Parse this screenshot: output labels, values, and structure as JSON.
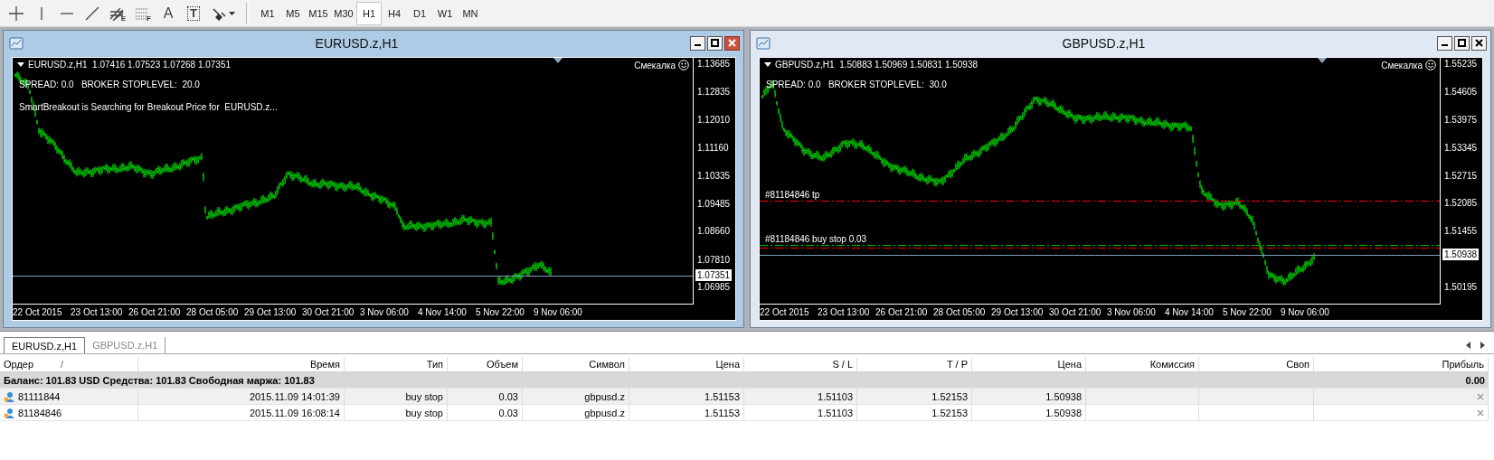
{
  "toolbar": {
    "tools": [
      {
        "kind": "crosshair"
      },
      {
        "kind": "vline"
      },
      {
        "kind": "hline"
      },
      {
        "kind": "trendline"
      },
      {
        "kind": "fibo_fan",
        "glyph": "E"
      },
      {
        "kind": "fibo_lines",
        "glyph": "F"
      },
      {
        "kind": "text",
        "glyph": "A"
      },
      {
        "kind": "label",
        "glyph": "T"
      },
      {
        "kind": "arrows"
      }
    ],
    "timeframes": [
      {
        "label": "M1",
        "selected": false
      },
      {
        "label": "M5",
        "selected": false
      },
      {
        "label": "M15",
        "selected": false
      },
      {
        "label": "M30",
        "selected": false
      },
      {
        "label": "H1",
        "selected": true
      },
      {
        "label": "H4",
        "selected": false
      },
      {
        "label": "D1",
        "selected": false
      },
      {
        "label": "W1",
        "selected": false
      },
      {
        "label": "MN",
        "selected": false
      }
    ]
  },
  "charts": [
    {
      "title": "EURUSD.z,H1",
      "active": true,
      "header": "EURUSD.z,H1  1.07416 1.07523 1.07268 1.07351",
      "expert": "Смекалка",
      "info_lines": [
        "SPREAD: 0.0   BROKER STOPLEVEL:  20.0",
        "SmartBreakout is Searching for Breakout Price for  EURUSD.z..."
      ],
      "price_ticks": [
        "1.13685",
        "1.12835",
        "1.12010",
        "1.11160",
        "1.10335",
        "1.09485",
        "1.08660",
        "1.07810",
        "1.06985"
      ],
      "current_price": "1.07351",
      "time_labels": [
        "22 Oct 2015",
        "23 Oct 13:00",
        "26 Oct 21:00",
        "28 Oct 05:00",
        "29 Oct 13:00",
        "30 Oct 21:00",
        "3 Nov 06:00",
        "4 Nov 14:00",
        "5 Nov 22:00",
        "9 Nov 06:00"
      ]
    },
    {
      "title": "GBPUSD.z,H1",
      "active": false,
      "header": "GBPUSD.z,H1  1.50883 1.50969 1.50831 1.50938",
      "expert": "Смекалка",
      "info_lines": [
        "SPREAD: 0.0   BROKER STOPLEVEL:  30.0"
      ],
      "price_ticks": [
        "1.55235",
        "1.54605",
        "1.53975",
        "1.53345",
        "1.52715",
        "1.52085",
        "1.51455",
        "1.50195"
      ],
      "current_price": "1.50938",
      "time_labels": [
        "22 Oct 2015",
        "23 Oct 13:00",
        "26 Oct 21:00",
        "28 Oct 05:00",
        "29 Oct 13:00",
        "30 Oct 21:00",
        "3 Nov 06:00",
        "4 Nov 14:00",
        "5 Nov 22:00",
        "9 Nov 06:00"
      ],
      "order_lines": [
        {
          "kind": "tp",
          "label": "#81184846 tp"
        },
        {
          "kind": "entry",
          "label": "#81184846 buy stop 0.03"
        },
        {
          "kind": "sl"
        }
      ]
    }
  ],
  "chart_tabs": [
    {
      "label": "EURUSD.z,H1",
      "selected": true
    },
    {
      "label": "GBPUSD.z,H1",
      "selected": false
    }
  ],
  "terminal": {
    "columns": [
      {
        "label": "Ордер",
        "sort_mark": "/"
      },
      {
        "label": "Время"
      },
      {
        "label": "Тип"
      },
      {
        "label": "Объем"
      },
      {
        "label": "Символ"
      },
      {
        "label": "Цена"
      },
      {
        "label": "S / L"
      },
      {
        "label": "T / P"
      },
      {
        "label": "Цена"
      },
      {
        "label": "Комиссия"
      },
      {
        "label": "Своп"
      },
      {
        "label": "Прибыль"
      }
    ],
    "balance": {
      "text": "Баланс: 101.83 USD  Средства: 101.83  Свободная маржа: 101.83",
      "profit": "0.00"
    },
    "rows": [
      {
        "order": "81111844",
        "time": "2015.11.09 14:01:39",
        "type": "buy stop",
        "volume": "0.03",
        "symbol": "gbpusd.z",
        "price": "1.51153",
        "sl": "1.51103",
        "tp": "1.52153",
        "current_price": "1.50938"
      },
      {
        "order": "81184846",
        "time": "2015.11.09 16:08:14",
        "type": "buy stop",
        "volume": "0.03",
        "symbol": "gbpusd.z",
        "price": "1.51153",
        "sl": "1.51103",
        "tp": "1.52153",
        "current_price": "1.50938"
      }
    ]
  }
}
